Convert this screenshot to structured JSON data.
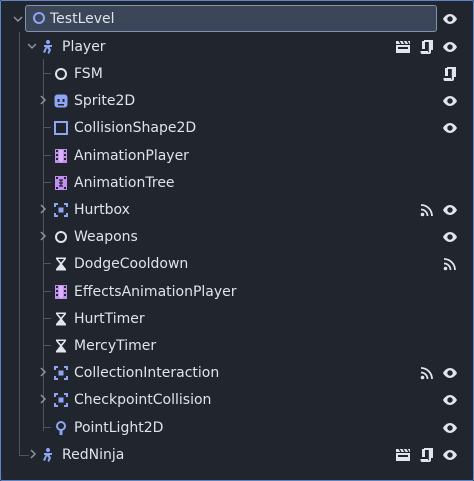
{
  "scene_tree": {
    "root": {
      "label": "TestLevel",
      "icon": "node-circle-icon"
    },
    "player": {
      "label": "Player",
      "icon": "character-body-icon"
    },
    "children": [
      {
        "label": "FSM",
        "icon": "node-circle-icon",
        "expandable": false,
        "right_icons": [
          "script-icon"
        ]
      },
      {
        "label": "Sprite2D",
        "icon": "sprite-icon",
        "expandable": true,
        "right_icons": [
          "eye-icon"
        ]
      },
      {
        "label": "CollisionShape2D",
        "icon": "collision-shape-icon",
        "expandable": false,
        "right_icons": [
          "eye-icon"
        ]
      },
      {
        "label": "AnimationPlayer",
        "icon": "animation-player-icon",
        "expandable": false,
        "right_icons": []
      },
      {
        "label": "AnimationTree",
        "icon": "animation-tree-icon",
        "expandable": false,
        "right_icons": []
      },
      {
        "label": "Hurtbox",
        "icon": "area-icon",
        "expandable": true,
        "right_icons": [
          "signal-icon",
          "eye-icon"
        ]
      },
      {
        "label": "Weapons",
        "icon": "node-circle-icon",
        "expandable": true,
        "right_icons": [
          "eye-icon"
        ]
      },
      {
        "label": "DodgeCooldown",
        "icon": "timer-icon",
        "expandable": false,
        "right_icons": [
          "signal-icon"
        ]
      },
      {
        "label": "EffectsAnimationPlayer",
        "icon": "animation-player-icon",
        "expandable": false,
        "right_icons": []
      },
      {
        "label": "HurtTimer",
        "icon": "timer-icon",
        "expandable": false,
        "right_icons": []
      },
      {
        "label": "MercyTimer",
        "icon": "timer-icon",
        "expandable": false,
        "right_icons": []
      },
      {
        "label": "CollectionInteraction",
        "icon": "area-icon",
        "expandable": true,
        "right_icons": [
          "signal-icon",
          "eye-icon"
        ]
      },
      {
        "label": "CheckpointCollision",
        "icon": "area-icon",
        "expandable": true,
        "right_icons": [
          "eye-icon"
        ]
      },
      {
        "label": "PointLight2D",
        "icon": "point-light-icon",
        "expandable": false,
        "right_icons": [
          "eye-icon"
        ]
      }
    ],
    "red_ninja": {
      "label": "RedNinja",
      "icon": "character-body-icon"
    },
    "colors": {
      "background": "#21262e",
      "selection": "#3b4658",
      "text": "#dfe3ea",
      "node_blue": "#8da5f3",
      "animation_purple": "#c38ef1",
      "light_yellow": "#f7d774",
      "guide": "#4c5564"
    }
  }
}
